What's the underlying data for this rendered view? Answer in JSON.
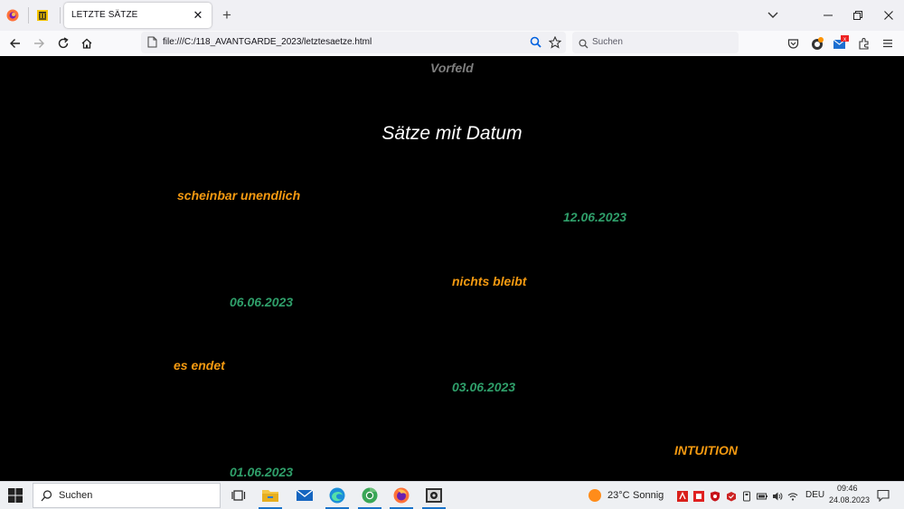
{
  "browser": {
    "tab_title": "LETZTE SÄTZE",
    "url": "file:///C:/118_AVANTGARDE_2023/letztesaetze.html",
    "search_placeholder": "Suchen"
  },
  "page": {
    "header": "Vorfeld",
    "title": "Sätze mit Datum",
    "entries": [
      {
        "sentence": "scheinbar unendlich",
        "date": "12.06.2023"
      },
      {
        "sentence": "nichts bleibt",
        "date": "06.06.2023"
      },
      {
        "sentence": "es endet",
        "date": "03.06.2023"
      },
      {
        "sentence": "INTUITION",
        "date": "01.06.2023"
      }
    ],
    "colors": {
      "background": "#000000",
      "sentence": "#f59a11",
      "date": "#2f9f6a",
      "header": "#7e7e7e",
      "title": "#ffffff"
    }
  },
  "taskbar": {
    "search_label": "Suchen",
    "weather_temp": "23°C",
    "weather_text": "Sonnig",
    "language": "DEU",
    "time": "09:46",
    "date": "24.08.2023",
    "apps": [
      "task-view-icon",
      "file-explorer-icon",
      "mail-icon",
      "edge-icon",
      "chrome-icon",
      "firefox-icon",
      "photo-viewer-icon"
    ]
  }
}
